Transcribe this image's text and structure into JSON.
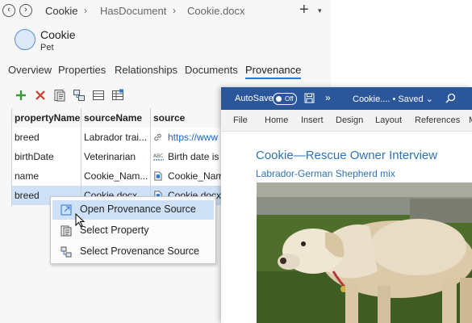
{
  "breadcrumb": {
    "root": "Cookie",
    "middle": "HasDocument",
    "current": "Cookie.docx",
    "separator": "›"
  },
  "entity": {
    "name": "Cookie",
    "type": "Pet"
  },
  "tabs": [
    "Overview",
    "Properties",
    "Relationships",
    "Documents",
    "Provenance"
  ],
  "grid": {
    "headers": [
      "propertyName",
      "sourceName",
      "source"
    ],
    "rows": [
      {
        "propertyName": "breed",
        "sourceName": "Labrador trai...",
        "source": "https://www"
      },
      {
        "propertyName": "birthDate",
        "sourceName": "Veterinarian",
        "source": "Birth date is"
      },
      {
        "propertyName": "name",
        "sourceName": "Cookie_Nam...",
        "source": "Cookie_Nam"
      },
      {
        "propertyName": "breed",
        "sourceName": "Cookie.docx",
        "source": "Cookie.docx"
      }
    ]
  },
  "context_menu": {
    "items": [
      "Open Provenance Source",
      "Select Property",
      "Select Provenance Source"
    ]
  },
  "word": {
    "autosave_label": "AutoSave",
    "autosave_state": "Off",
    "more": "»",
    "title": "Cookie.... • Saved",
    "title_chevron": "⌄",
    "menu": [
      "File",
      "Home",
      "Insert",
      "Design",
      "Layout",
      "References",
      "M"
    ],
    "heading": "Cookie—Rescue Owner Interview",
    "subheading": "Labrador-German Shepherd mix"
  },
  "colors": {
    "accent": "#2b78d0",
    "word_blue": "#2b579a",
    "selection": "#cfe1f6",
    "doc_heading": "#2e74b5"
  }
}
